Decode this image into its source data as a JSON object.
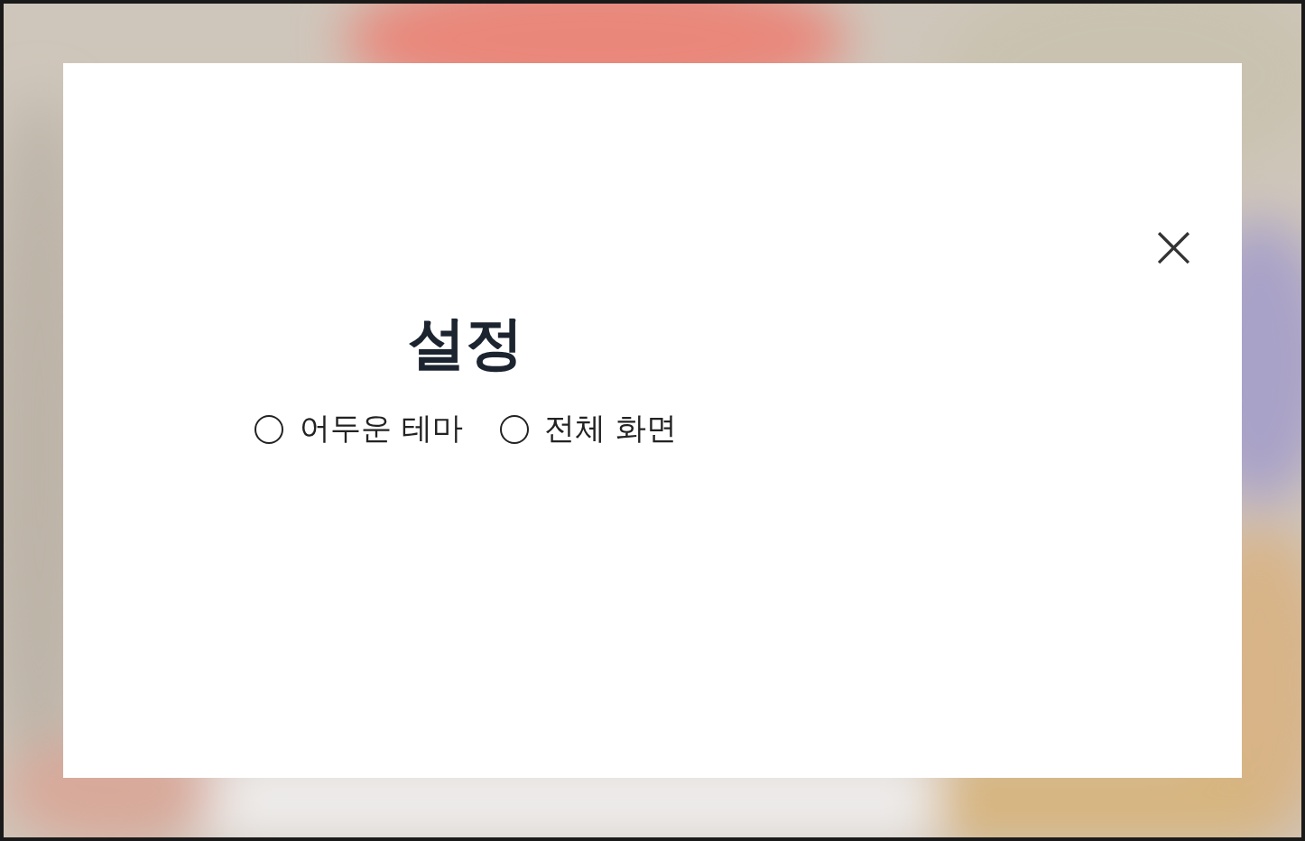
{
  "dialog": {
    "title": "설정",
    "close": "×",
    "options": [
      {
        "label": "어두운 테마",
        "selected": false
      },
      {
        "label": "전체 화면",
        "selected": false
      }
    ]
  }
}
